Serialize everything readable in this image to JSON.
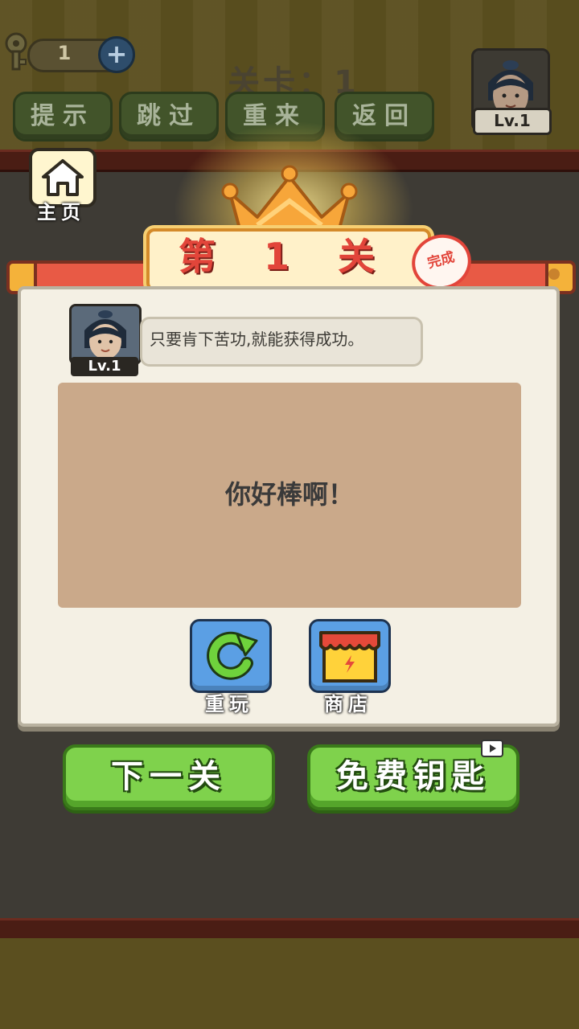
{
  "header": {
    "key_count": "1",
    "level_title": "关卡：1",
    "buttons": [
      "提示",
      "跳过",
      "重来",
      "返回"
    ],
    "avatar_level": "Lv.1"
  },
  "home": {
    "label": "主页"
  },
  "level_card": {
    "title": "第 1 关",
    "stamp": "完成"
  },
  "panel": {
    "avatar_level": "Lv.1",
    "message": "只要肯下苦功,就能获得成功。",
    "board_text": "你好棒啊！",
    "replay_label": "重玩",
    "shop_label": "商店"
  },
  "actions": {
    "next_label": "下一关",
    "free_key_label": "免费钥匙"
  },
  "colors": {
    "ribbon": "#e85a45",
    "title_red": "#e2453a",
    "green_button": "#7fd24c",
    "square_button_blue": "#5b9fe4",
    "board": "#caa98a",
    "panel": "#f4f0e4"
  }
}
